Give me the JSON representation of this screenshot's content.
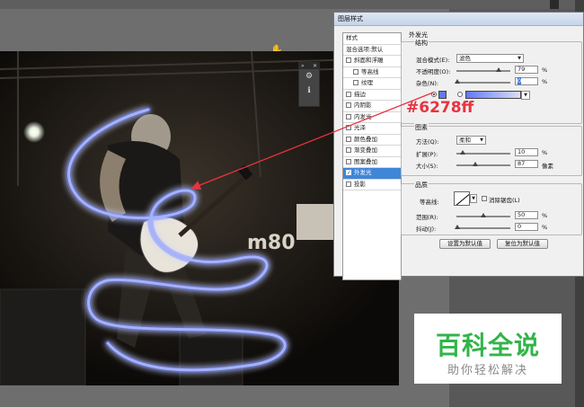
{
  "dialog": {
    "title": "图层样式",
    "section_title": "外发光"
  },
  "styles_list": [
    {
      "label": "样式",
      "checkbox": false,
      "indent": false,
      "active": false,
      "checked": false
    },
    {
      "label": "混合选项:默认",
      "checkbox": false,
      "indent": false,
      "active": false,
      "checked": false
    },
    {
      "label": "斜面和浮雕",
      "checkbox": true,
      "indent": false,
      "active": false,
      "checked": false
    },
    {
      "label": "等高线",
      "checkbox": true,
      "indent": true,
      "active": false,
      "checked": false
    },
    {
      "label": "纹理",
      "checkbox": true,
      "indent": true,
      "active": false,
      "checked": false
    },
    {
      "label": "描边",
      "checkbox": true,
      "indent": false,
      "active": false,
      "checked": false
    },
    {
      "label": "内阴影",
      "checkbox": true,
      "indent": false,
      "active": false,
      "checked": false
    },
    {
      "label": "内发光",
      "checkbox": true,
      "indent": false,
      "active": false,
      "checked": false
    },
    {
      "label": "光泽",
      "checkbox": true,
      "indent": false,
      "active": false,
      "checked": false
    },
    {
      "label": "颜色叠加",
      "checkbox": true,
      "indent": false,
      "active": false,
      "checked": false
    },
    {
      "label": "渐变叠加",
      "checkbox": true,
      "indent": false,
      "active": false,
      "checked": false
    },
    {
      "label": "图案叠加",
      "checkbox": true,
      "indent": false,
      "active": false,
      "checked": false
    },
    {
      "label": "外发光",
      "checkbox": true,
      "indent": false,
      "active": true,
      "checked": true
    },
    {
      "label": "投影",
      "checkbox": true,
      "indent": false,
      "active": false,
      "checked": false
    }
  ],
  "structure": {
    "label": "结构",
    "blend_mode_label": "混合模式(E):",
    "blend_mode_value": "滤色",
    "opacity_label": "不透明度(O):",
    "opacity_value": "79",
    "noise_label": "杂色(N):",
    "noise_value": "0",
    "percent": "%",
    "glow_color": "#6278ff"
  },
  "elements": {
    "label": "图素",
    "technique_label": "方法(Q):",
    "technique_value": "柔和",
    "spread_label": "扩展(P):",
    "spread_value": "10",
    "size_label": "大小(S):",
    "size_value": "87",
    "px_unit": "像素",
    "percent": "%"
  },
  "quality": {
    "label": "品质",
    "contour_label": "等高线:",
    "antialias_label": "消除锯齿(L)",
    "range_label": "范围(R):",
    "range_value": "50",
    "jitter_label": "抖动(J):",
    "jitter_value": "0",
    "percent": "%"
  },
  "buttons": {
    "set_default": "设置为默认值",
    "reset_default": "复位为默认值"
  },
  "annotation": {
    "hex": "#6278ff",
    "color": "#e8333f"
  },
  "canvas": {
    "sign_text": "m80",
    "neon_color": "#6278ff"
  },
  "watermark": {
    "title": "百科全说",
    "subtitle": "助你轻松解决"
  }
}
